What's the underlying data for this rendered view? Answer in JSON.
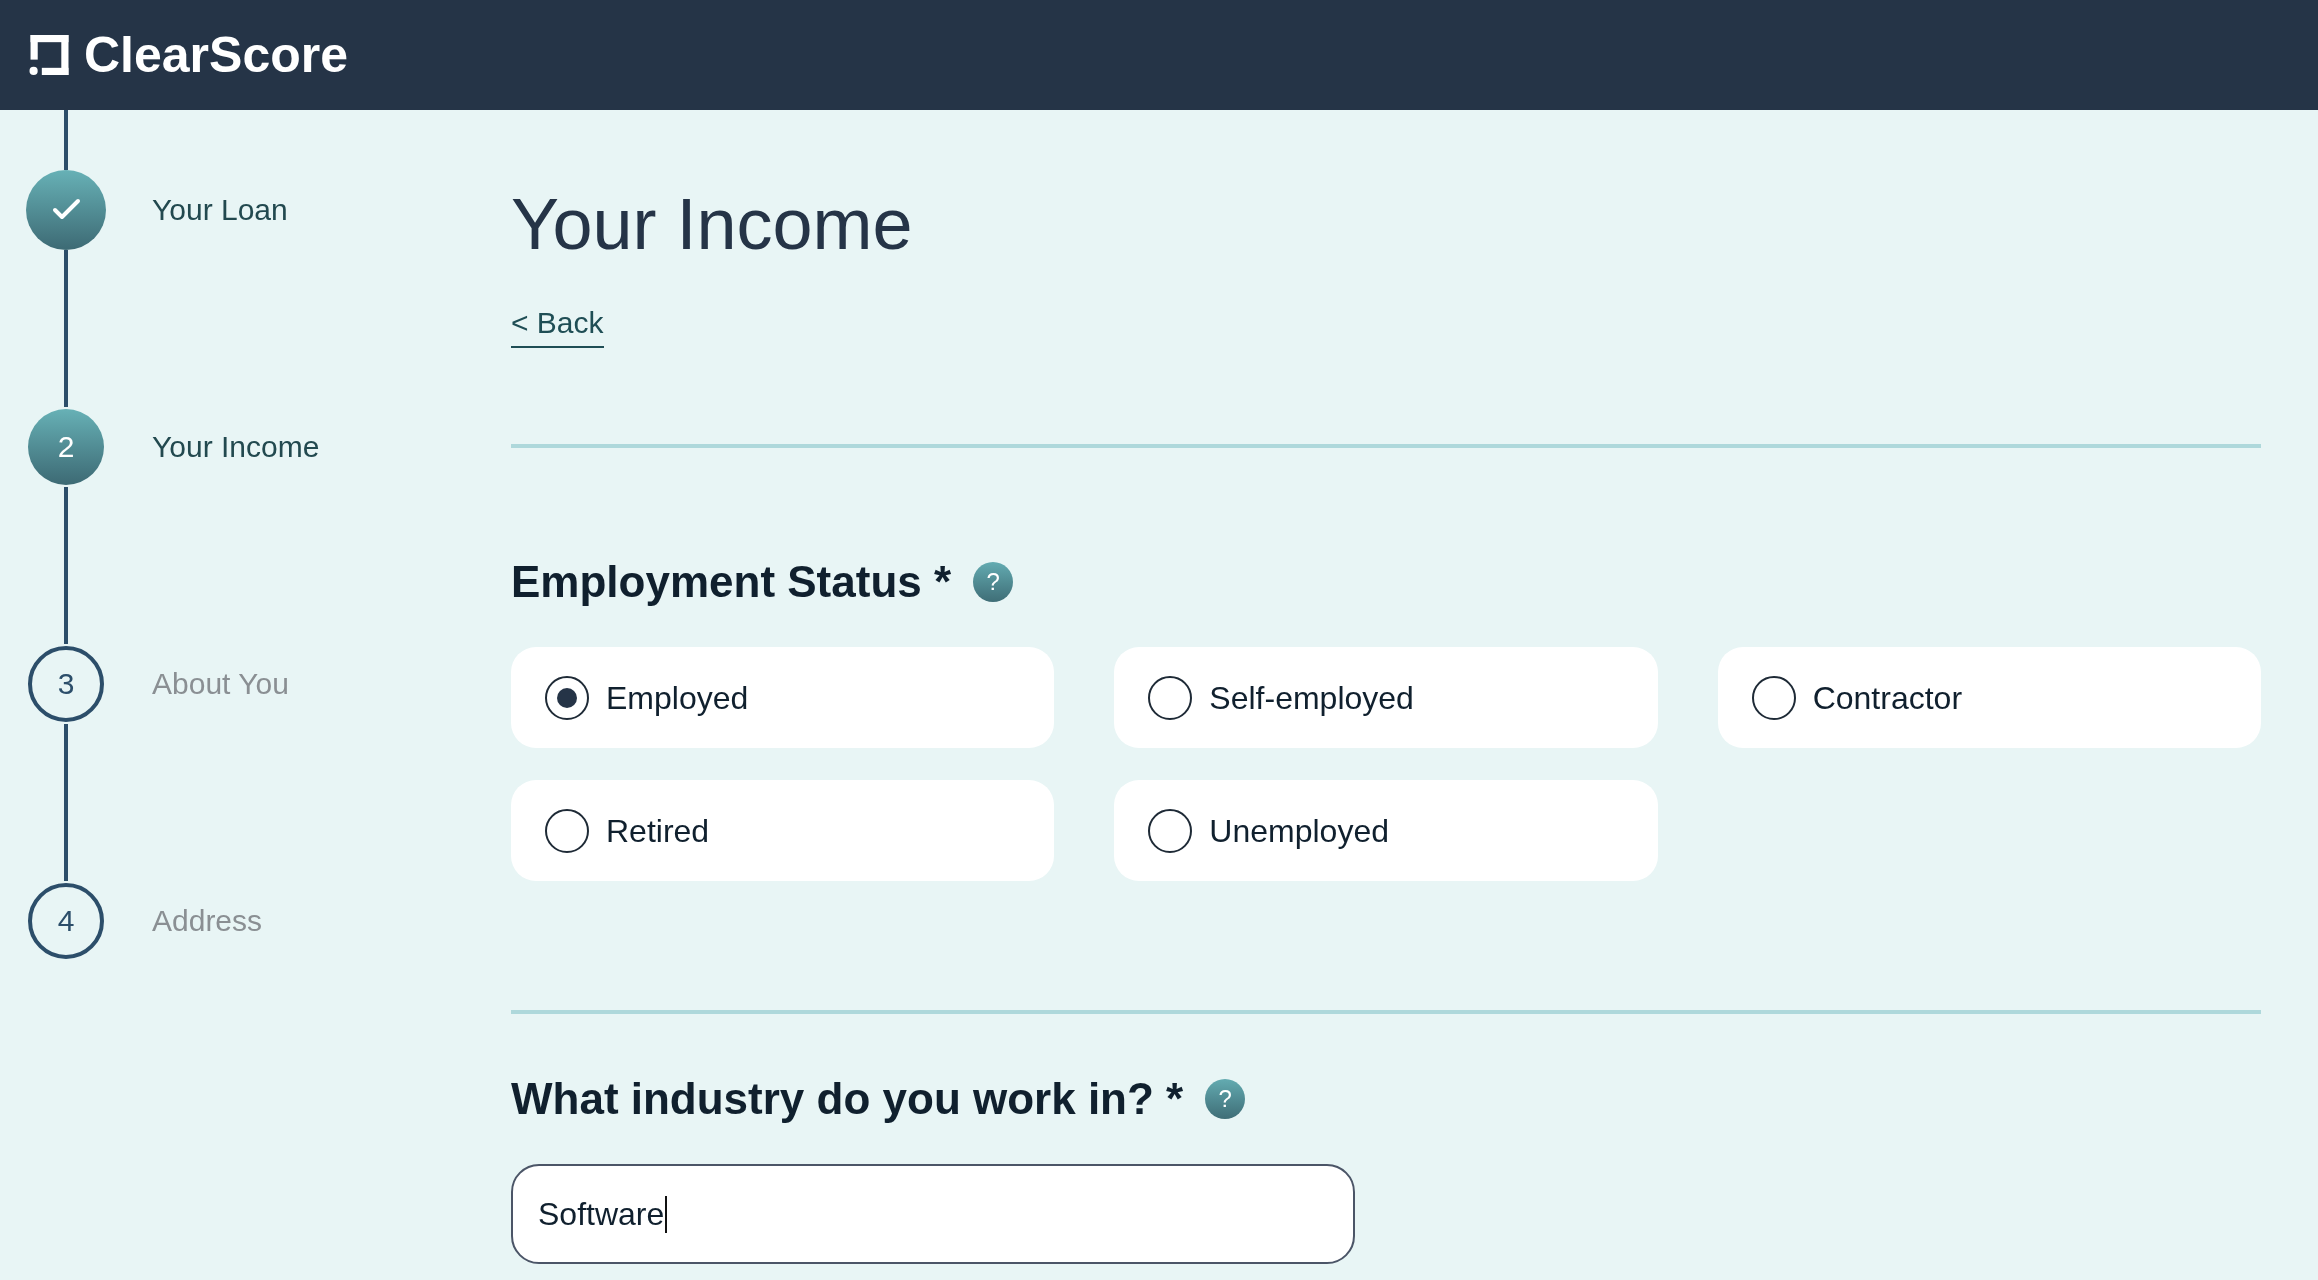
{
  "header": {
    "logo_text": "ClearScore"
  },
  "steps": [
    {
      "label": "Your Loan",
      "completed": true,
      "selected": false
    },
    {
      "number": "2",
      "label": "Your Income",
      "completed": false,
      "selected": true
    },
    {
      "number": "3",
      "label": "About You",
      "completed": false,
      "selected": false
    },
    {
      "number": "4",
      "label": "Address",
      "completed": false,
      "selected": false
    }
  ],
  "page": {
    "title": "Your Income",
    "back_link": "< Back"
  },
  "employment_status": {
    "heading": "Employment Status *",
    "help": "?",
    "options": [
      {
        "label": "Employed",
        "selected": true
      },
      {
        "label": "Self-employed",
        "selected": false
      },
      {
        "label": "Contractor",
        "selected": false
      },
      {
        "label": "Retired",
        "selected": false
      },
      {
        "label": "Unemployed",
        "selected": false
      }
    ]
  },
  "industry": {
    "heading": "What industry do you work in? *",
    "help": "?",
    "field": {
      "value": "Software",
      "focused": true
    }
  }
}
